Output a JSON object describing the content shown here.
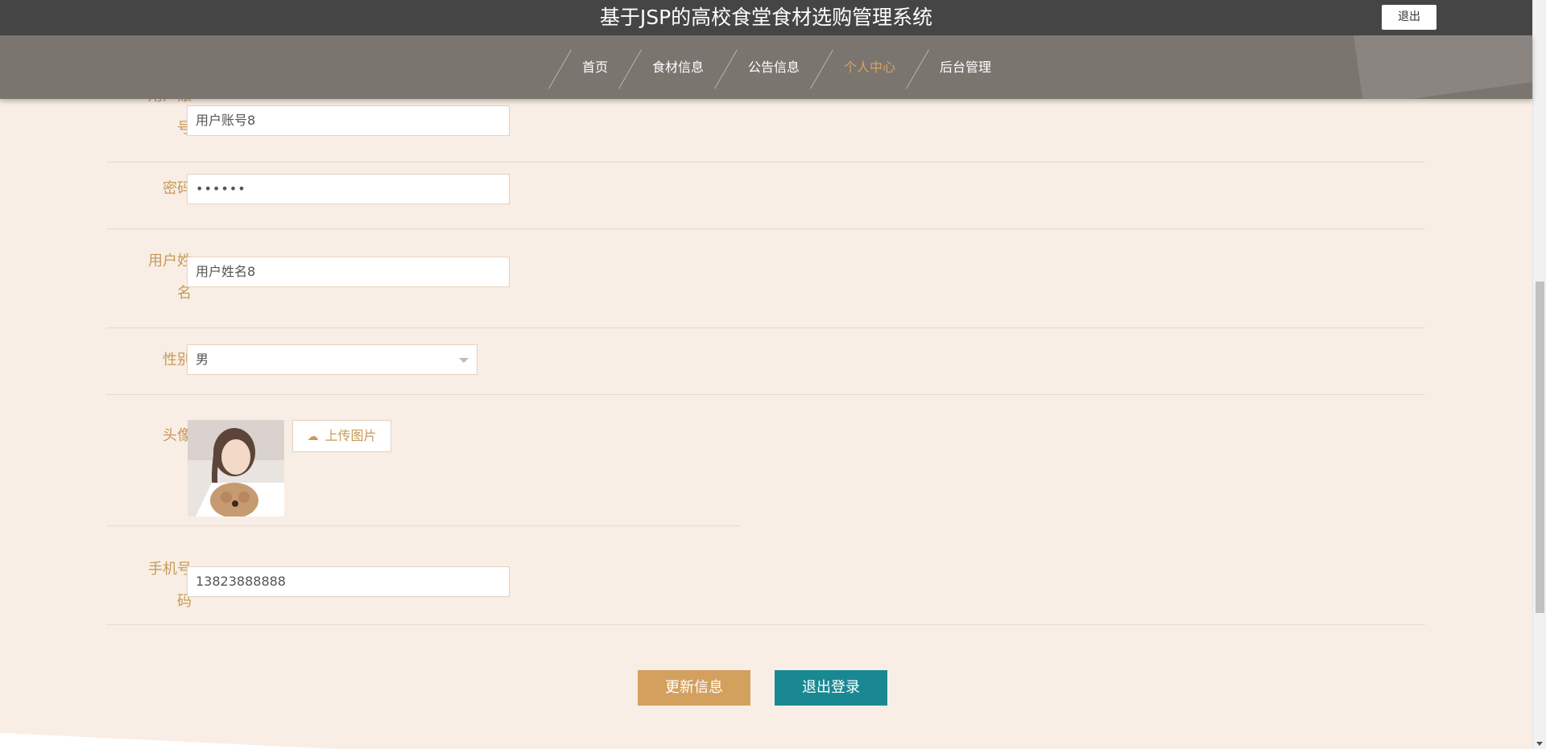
{
  "header": {
    "title": "基于JSP的高校食堂食材选购管理系统",
    "logout_label": "退出"
  },
  "nav": {
    "items": [
      {
        "label": "首页"
      },
      {
        "label": "食材信息"
      },
      {
        "label": "公告信息"
      },
      {
        "label": "个人中心"
      },
      {
        "label": "后台管理"
      }
    ],
    "active": "个人中心"
  },
  "form": {
    "account": {
      "label_line1": "用户账",
      "label_line2": "号",
      "value": "用户账号8"
    },
    "password": {
      "label": "密码",
      "value": "••••••"
    },
    "name": {
      "label_line1": "用户姓",
      "label_line2": "名",
      "value": "用户姓名8"
    },
    "gender": {
      "label": "性别",
      "value": "男"
    },
    "avatar": {
      "label": "头像",
      "upload_label": "上传图片"
    },
    "phone": {
      "label_line1": "手机号",
      "label_line2": "码",
      "value": "13823888888"
    }
  },
  "buttons": {
    "update_label": "更新信息",
    "logout_label": "退出登录"
  },
  "colors": {
    "header_bg": "#454545",
    "nav_bg": "#7b7570",
    "nav_active": "#d8a35b",
    "page_bg": "#f9eee5",
    "label": "#c69a5a",
    "update_button": "#d3a05e",
    "logout_button": "#1a8893"
  },
  "icons": {
    "upload": "cloud-upload-icon",
    "select": "chevron-down-icon"
  }
}
